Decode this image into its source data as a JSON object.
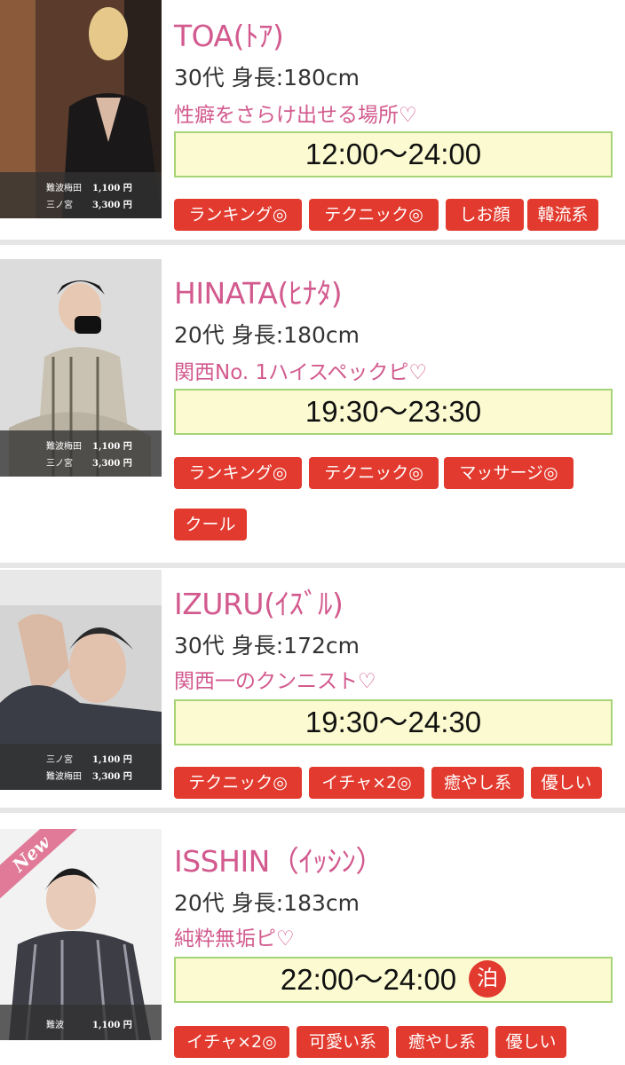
{
  "cast": [
    {
      "name": "TOA(ﾄｱ)",
      "profile": "30代 身長:180cm",
      "catch": "性癖をさらけ出せる場所♡",
      "time": "12:00〜24:00",
      "stay": "",
      "new_badge": "",
      "prices": [
        {
          "area": "難波梅田",
          "price": "1,100 円"
        },
        {
          "area": "三ノ宮",
          "price": "3,300 円"
        }
      ],
      "tags": [
        "ランキング◎",
        "テクニック◎",
        "しお顔",
        "韓流系"
      ]
    },
    {
      "name": "HINATA(ﾋﾅﾀ)",
      "profile": "20代 身長:180cm",
      "catch": "関西No. 1ハイスペックピ♡",
      "time": "19:30〜23:30",
      "stay": "",
      "new_badge": "",
      "prices": [
        {
          "area": "難波梅田",
          "price": "1,100 円"
        },
        {
          "area": "三ノ宮",
          "price": "3,300 円"
        }
      ],
      "tags": [
        "ランキング◎",
        "テクニック◎",
        "マッサージ◎",
        "クール"
      ]
    },
    {
      "name": "IZURU(ｲｽﾞﾙ)",
      "profile": "30代 身長:172cm",
      "catch": "関西一のクンニスト♡",
      "time": "19:30〜24:30",
      "stay": "",
      "new_badge": "",
      "prices": [
        {
          "area": "三ノ宮",
          "price": "1,100 円"
        },
        {
          "area": "難波梅田",
          "price": "3,300 円"
        }
      ],
      "tags": [
        "テクニック◎",
        "イチャ×2◎",
        "癒やし系",
        "優しい"
      ]
    },
    {
      "name": "ISSHIN（ｲｯｼﾝ）",
      "profile": "20代 身長:183cm",
      "catch": "純粋無垢ピ♡",
      "time": "22:00〜24:00",
      "stay": "泊",
      "new_badge": "New",
      "prices": [
        {
          "area": "難波",
          "price": "1,100 円"
        }
      ],
      "tags": [
        "イチャ×2◎",
        "可愛い系",
        "癒やし系",
        "優しい"
      ]
    }
  ]
}
